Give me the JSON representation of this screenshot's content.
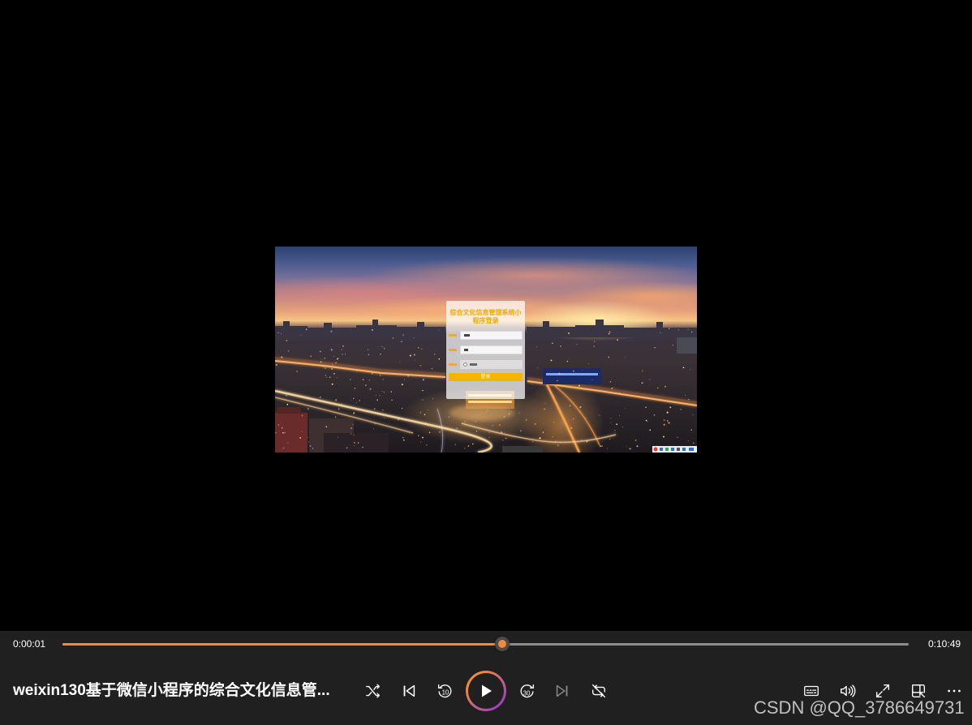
{
  "video_frame": {
    "login_card": {
      "title": "综合文化信息管理系统小程序登录",
      "button_label": "登录",
      "title_color": "#f2a900",
      "button_color": "#f5b400"
    }
  },
  "player": {
    "current_time": "0:00:01",
    "total_time": "0:10:49",
    "progress": 0.52,
    "title": "weixin130基于微信小程序的综合文化信息管...",
    "accent_color": "#f28a3c",
    "play_ring_colors": [
      "#f28a3c",
      "#a040c0"
    ]
  },
  "controls": {
    "center_icons": [
      "shuffle-icon",
      "previous-icon",
      "rewind-10-icon",
      "play-icon",
      "forward-30-icon",
      "next-icon",
      "repeat-icon"
    ],
    "right_icons": [
      "captions-icon",
      "volume-icon",
      "fullscreen-icon",
      "mini-player-icon",
      "more-icon"
    ],
    "rewind_seconds": "10",
    "forward_seconds": "30"
  },
  "watermark": "CSDN @QQ_3786649731"
}
